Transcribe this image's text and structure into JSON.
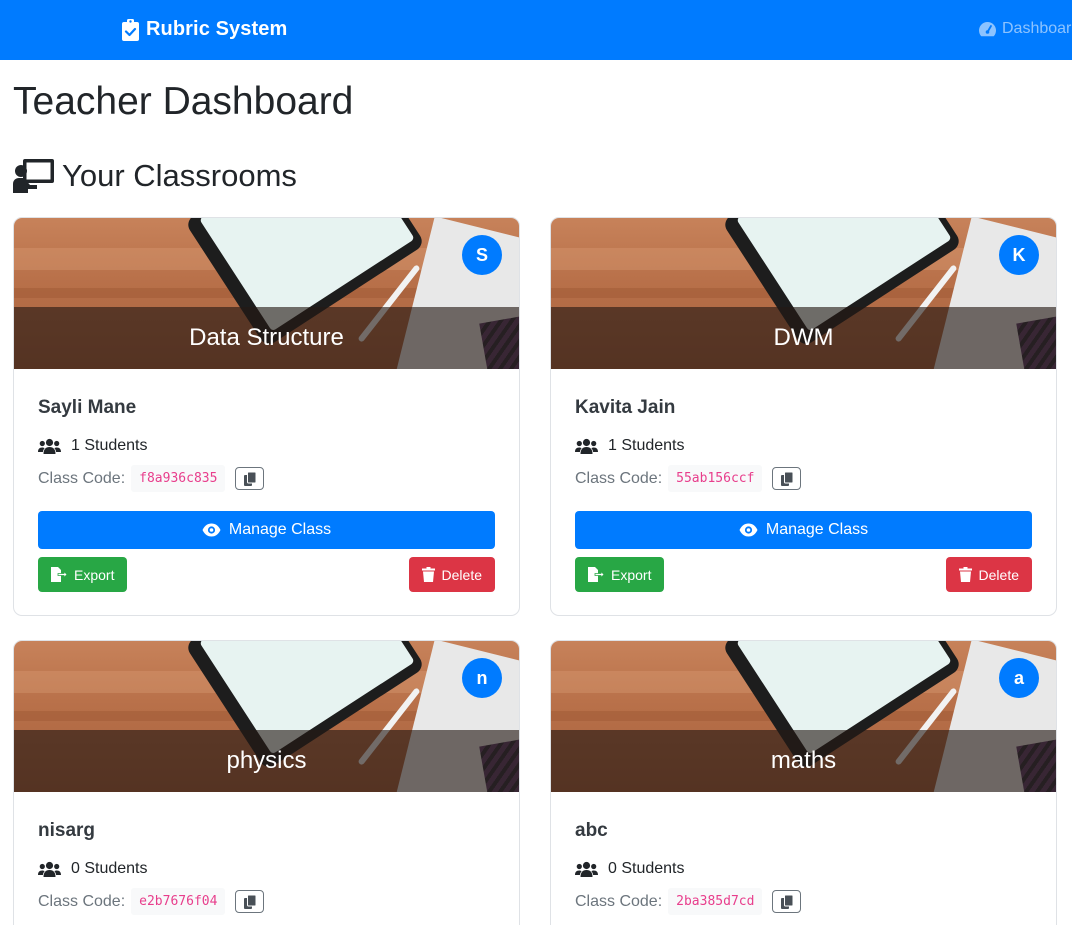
{
  "navbar": {
    "brand": "Rubric System",
    "brand_icon": "clipboard-check-icon",
    "link_dashboard": "Dashboard",
    "link_icon": "tachometer-icon",
    "background": "#007bff"
  },
  "page": {
    "title": "Teacher Dashboard",
    "section_title": "Your Classrooms",
    "section_icon": "chalkboard-teacher-icon"
  },
  "buttons": {
    "manage": "Manage Class",
    "export": "Export",
    "delete": "Delete",
    "students_suffix": "Students",
    "class_code_label": "Class Code:"
  },
  "colors": {
    "primary": "#007bff",
    "success": "#28a745",
    "danger": "#dc3545",
    "code": "#e83e8c"
  },
  "classrooms": [
    {
      "name": "Data Structure",
      "avatar": "S",
      "teacher": "Sayli Mane",
      "students": "1 Students",
      "code": "f8a936c835"
    },
    {
      "name": "DWM",
      "avatar": "K",
      "teacher": "Kavita Jain",
      "students": "1 Students",
      "code": "55ab156ccf"
    },
    {
      "name": "physics",
      "avatar": "n",
      "teacher": "nisarg",
      "students": "0 Students",
      "code": "e2b7676f04"
    },
    {
      "name": "maths",
      "avatar": "a",
      "teacher": "abc",
      "students": "0 Students",
      "code": "2ba385d7cd"
    }
  ]
}
